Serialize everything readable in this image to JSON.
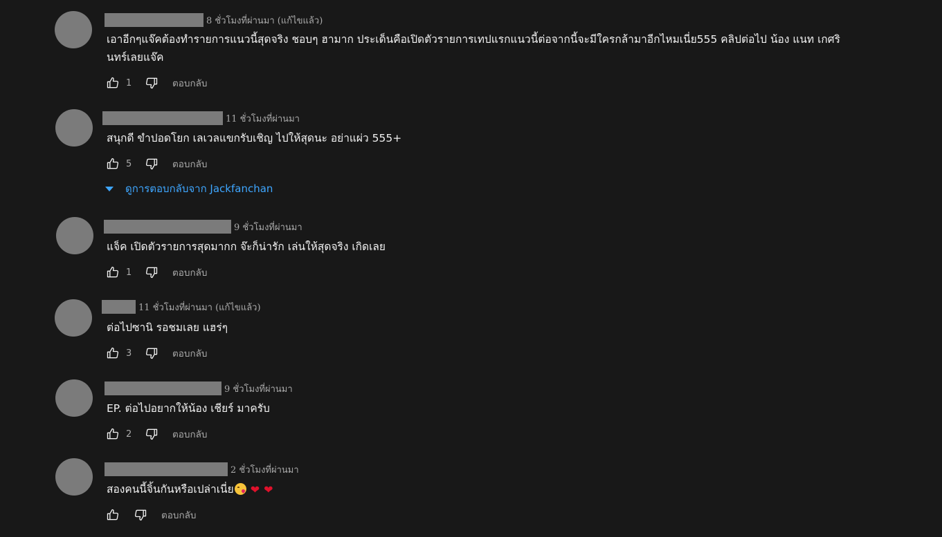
{
  "comments": [
    {
      "time": "8 ชั่วโมงที่ผ่านมา (แก้ไขแล้ว)",
      "text": "เอาอีกๆแจ๊คต้องทำรายการแนวนี้สุดจริง ชอบๆ ฮามาก ประเด็นคือเปิดตัวรายการเทปแรกแนวนี้ต่อจากนี้จะมีใครกล้ามาอีกไหมเนี่ย555 คลิปต่อไป น้อง แนท เกศรินทร์เลยแจ๊ค",
      "likes": "1",
      "reply_label": "ตอบกลับ"
    },
    {
      "time": "11 ชั่วโมงที่ผ่านมา",
      "text": "สนุกดี ขำปอดโยก เลเวลแขกรับเชิญ ไปให้สุดนะ อย่าแผ่ว 555+",
      "likes": "5",
      "reply_label": "ตอบกลับ",
      "view_replies": "ดูการตอบกลับจาก Jackfanchan"
    },
    {
      "time": "9 ชั่วโมงที่ผ่านมา",
      "text": "แจ็ค  เปิดตัวรายการสุดมากก  จ๊ะก็น่ารัก เล่นให้สุดจริง  เกิดเลย",
      "likes": "1",
      "reply_label": "ตอบกลับ"
    },
    {
      "time": "11 ชั่วโมงที่ผ่านมา (แก้ไขแล้ว)",
      "text": "ต่อไปซานิ รอชมเลย แฮร่ๆ",
      "likes": "3",
      "reply_label": "ตอบกลับ"
    },
    {
      "time": "9 ชั่วโมงที่ผ่านมา",
      "text": "EP. ต่อไปอยากให้น้อง เชียร์ มาครับ",
      "likes": "2",
      "reply_label": "ตอบกลับ"
    },
    {
      "time": "2 ชั่วโมงที่ผ่านมา",
      "text": "สองคนนี้จิ้นกันหรือเปล่าเนี่ย",
      "likes": "",
      "reply_label": "ตอบกลับ",
      "emojis": [
        "kissing-face-icon",
        "red-heart-icon",
        "red-heart-icon"
      ]
    }
  ],
  "colors": {
    "background": "#181818",
    "text": "#f1f1f1",
    "meta": "#aaaaaa",
    "link": "#3ea6ff",
    "redacted": "#7b7b7b"
  }
}
